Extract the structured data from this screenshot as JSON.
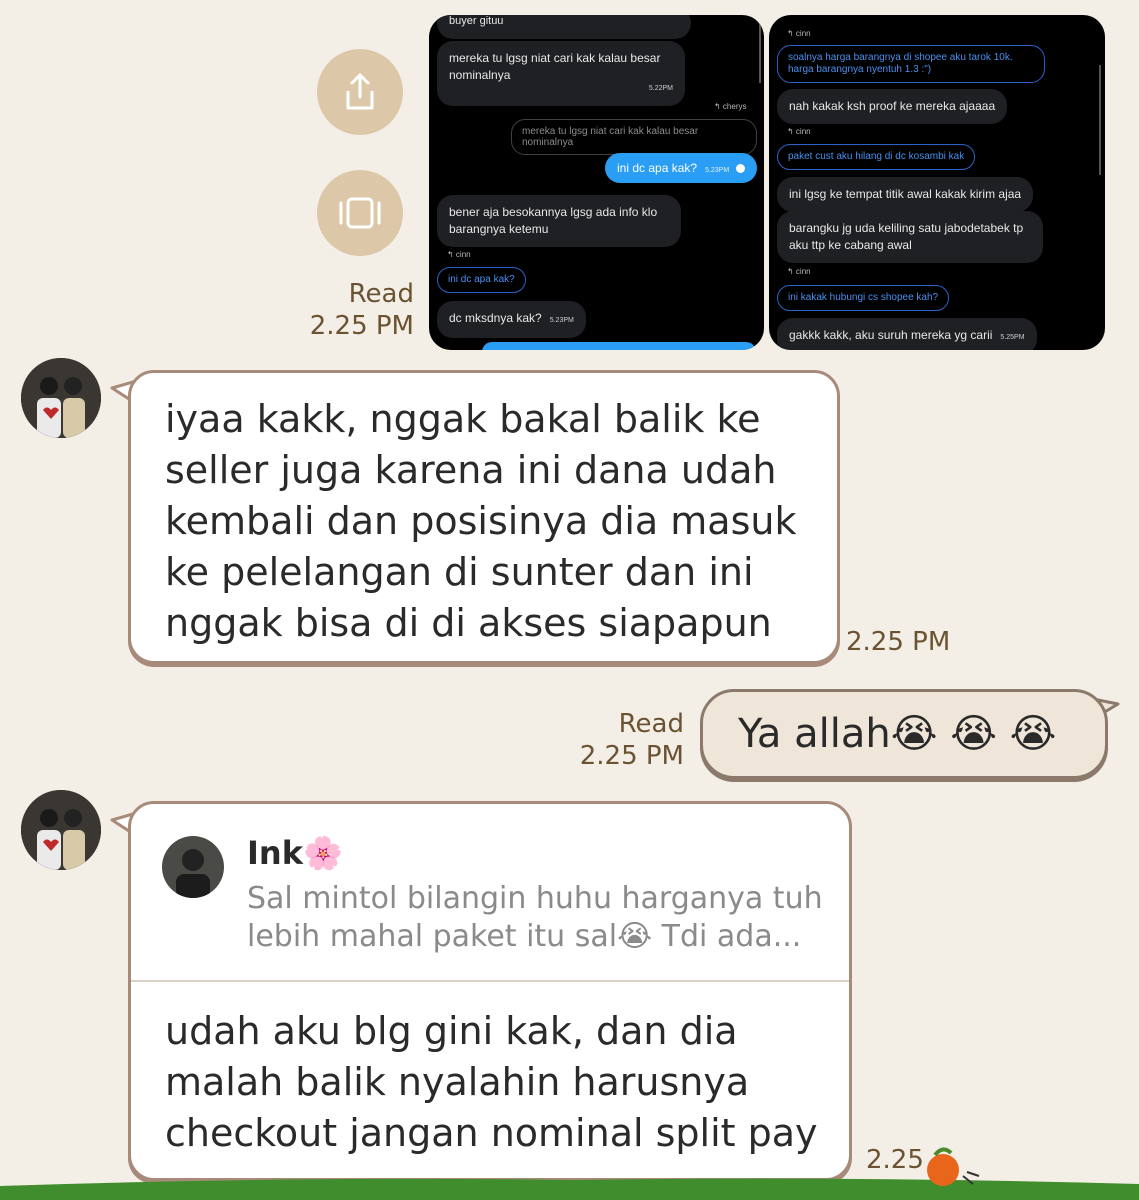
{
  "actions": {
    "share_icon": "share-icon",
    "screenshot_icon": "screenshot-icon"
  },
  "attachment_meta": {
    "read": "Read",
    "time": "2.25 PM"
  },
  "left_shot": {
    "top_partial": "buyer gituu",
    "m1": "mereka tu lgsg niat cari kak kalau besar nominalnya",
    "m1_time": "5.22PM",
    "reply_label1": "↰ cherys",
    "quoted1": "mereka tu lgsg niat cari kak kalau besar nominalnya",
    "blue1": "ini dc apa kak?",
    "blue1_time": "5.23PM",
    "m2": "bener aja besokannya lgsg ada info klo barangnya ketemu",
    "reply_label2": "↰ cinn",
    "quoted2": "ini dc apa kak?",
    "m3": "dc mksdnya kak?",
    "m3_time": "5.23PM"
  },
  "right_shot": {
    "reply_label1": "↰ cinn",
    "quoted1": "soalnya harga barangnya di shopee aku tarok 10k. harga barangnya nyentuh 1.3 :\")",
    "m1": "nah kakak ksh proof ke mereka ajaaaa",
    "reply_label2": "↰ cinn",
    "quoted2": "paket cust aku hilang di dc kosambi kak",
    "m2": "ini lgsg ke tempat titik awal kakak kirim ajaa",
    "m3": "barangku jg uda keliling satu jabodetabek tp aku ttp ke cabang awal",
    "reply_label3": "↰ cinn",
    "quoted3": "ini kakak hubungi cs shopee kah?",
    "m4": "gakkk kakk, aku suruh mereka yg carii",
    "m4_time": "5.25PM"
  },
  "msg1": {
    "text": "iyaa kakk, nggak bakal balik ke seller juga karena ini dana udah kembali dan posisinya dia masuk ke pelelangan di sunter dan ini nggak bisa di di akses siapapun",
    "time": "2.25 PM"
  },
  "msg2": {
    "text": "Ya allah😭 😭 😭",
    "read": "Read",
    "time": "2.25 PM"
  },
  "msg3": {
    "reply_name": "Ink🌸",
    "reply_preview": "Sal mintol bilangin huhu harganya tuh lebih mahal paket itu sal😭  Tdi ada...",
    "text": "udah aku blg gini kak, dan dia malah balik nyalahin harusnya checkout jangan nominal split pay",
    "time": "2.25"
  },
  "colors": {
    "background": "#f3eee6",
    "bubble_border": "#a88a7a",
    "meta_text": "#6b5332",
    "accent_blue": "#2a9df4",
    "grass": "#3f8d2c"
  }
}
